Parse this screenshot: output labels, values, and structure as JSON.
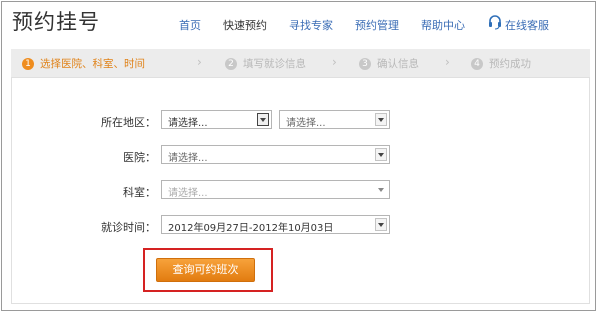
{
  "header": {
    "logo": "预约挂号",
    "nav": [
      {
        "label": "首页"
      },
      {
        "label": "快速预约"
      },
      {
        "label": "寻找专家"
      },
      {
        "label": "预约管理"
      },
      {
        "label": "帮助中心"
      },
      {
        "label": "在线客服",
        "icon": "headset-icon"
      }
    ],
    "active_nav": "快速预约"
  },
  "steps": [
    {
      "num": "1",
      "label": "选择医院、科室、时间",
      "active": true
    },
    {
      "num": "2",
      "label": "填写就诊信息",
      "active": false
    },
    {
      "num": "3",
      "label": "确认信息",
      "active": false
    },
    {
      "num": "4",
      "label": "预约成功",
      "active": false
    }
  ],
  "form": {
    "region_label": "所在地区：",
    "region_province": "请选择...",
    "region_city": "请选择...",
    "hospital_label": "医院：",
    "hospital_value": "请选择...",
    "department_label": "科室：",
    "department_value": "请选择...",
    "date_label": "就诊时间：",
    "date_value": "2012年09月27日-2012年10月03日",
    "submit_label": "查询可约班次"
  },
  "colors": {
    "accent": "#ef8d1f",
    "link": "#3a6cb5",
    "highlight_box": "#d52222"
  }
}
